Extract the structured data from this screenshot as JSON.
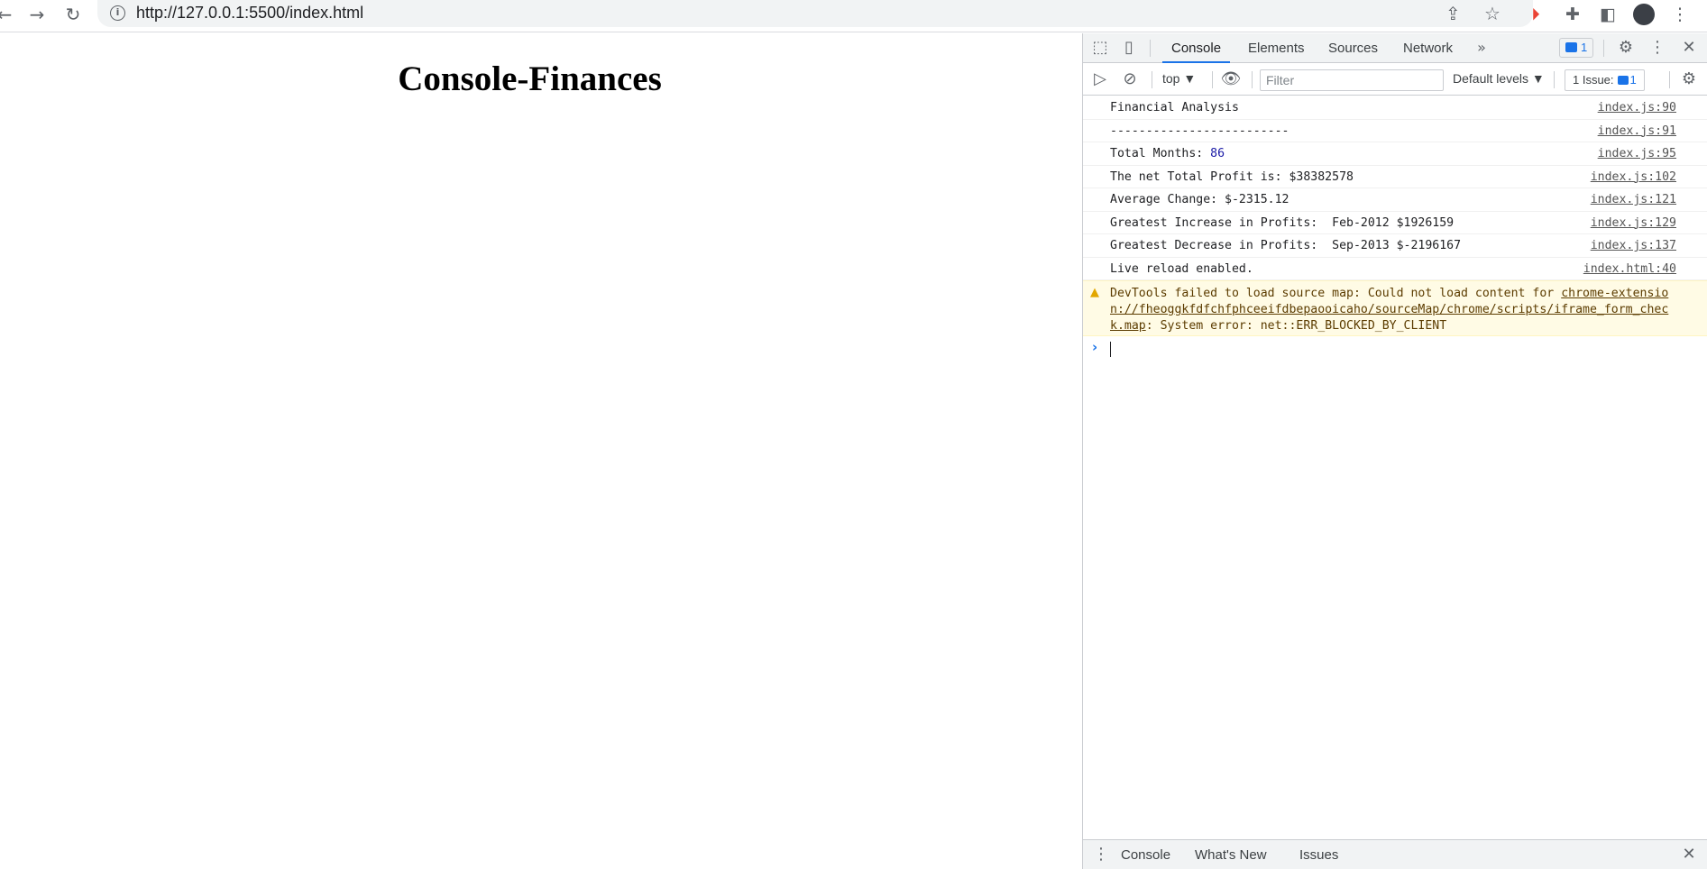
{
  "browser": {
    "url": "http://127.0.0.1:5500/index.html"
  },
  "page": {
    "heading": "Console-Finances"
  },
  "devtools": {
    "tabs": [
      "Console",
      "Elements",
      "Sources",
      "Network"
    ],
    "more_tabs_glyph": "»",
    "messages_badge": "1",
    "toolbar": {
      "context": "top",
      "filter_placeholder": "Filter",
      "levels": "Default levels",
      "issues_label": "1 Issue:",
      "issues_count": "1"
    },
    "console_lines": [
      {
        "text": "Financial Analysis",
        "source": "index.js:90"
      },
      {
        "text": "-------------------------",
        "source": "index.js:91"
      },
      {
        "text": "Total Months: ",
        "value": "86",
        "source": "index.js:95"
      },
      {
        "text": "The net Total Profit is: $38382578",
        "source": "index.js:102"
      },
      {
        "text": "Average Change: $-2315.12",
        "source": "index.js:121"
      },
      {
        "text": "Greatest Increase in Profits:  Feb-2012 $1926159",
        "source": "index.js:129"
      },
      {
        "text": "Greatest Decrease in Profits:  Sep-2013 $-2196167",
        "source": "index.js:137"
      },
      {
        "text": "Live reload enabled.",
        "source": "index.html:40"
      }
    ],
    "warning": {
      "prefix": "DevTools failed to load source map: Could not load content for ",
      "link": "chrome-extension://fheoggkfdfchfphceeifdbepaooicaho/sourceMap/chrome/scripts/iframe_form_check.map",
      "suffix": ": System error: net::ERR_BLOCKED_BY_CLIENT"
    },
    "drawer_tabs": [
      "Console",
      "What's New",
      "Issues"
    ]
  }
}
